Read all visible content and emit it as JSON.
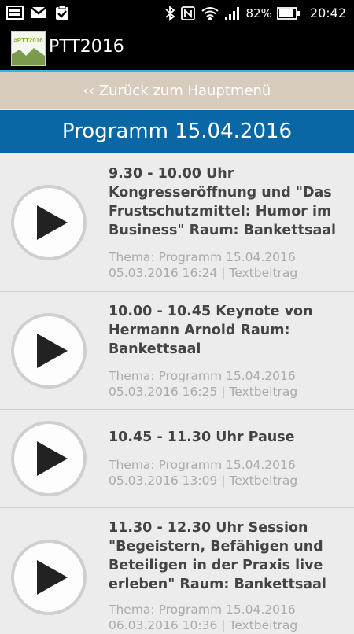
{
  "status_bar": {
    "left_icons": [
      "gallery-icon",
      "gmail-icon",
      "clipboard-check-icon"
    ],
    "battery_percent": "82%",
    "time": "20:42"
  },
  "app_bar": {
    "logo_text": "#PTT2016",
    "title": "PTT2016"
  },
  "back_link": "‹‹ Zurück zum Hauptmenü",
  "section_title": "Programm 15.04.2016",
  "items": [
    {
      "title_lines": [
        "9.30 - 10.00 Uhr",
        "Kongresseröffnung und \"Das",
        "Frustschutzmittel: Humor im",
        "Business\" Raum: Bankettsaal"
      ],
      "topic": "Thema: Programm 15.04.2016",
      "meta": "05.03.2016 16:24 | Textbeitrag"
    },
    {
      "title_lines": [
        "10.00 - 10.45 Keynote von",
        "Hermann Arnold Raum:",
        "Bankettsaal"
      ],
      "topic": "Thema: Programm 15.04.2016",
      "meta": "05.03.2016 16:25 | Textbeitrag"
    },
    {
      "title_lines": [
        "10.45 - 11.30 Uhr Pause"
      ],
      "topic": "Thema: Programm 15.04.2016",
      "meta": "05.03.2016 13:09 | Textbeitrag"
    },
    {
      "title_lines": [
        "11.30 - 12.30 Uhr Session",
        "\"Begeistern, Befähigen und",
        "Beteiligen in der Praxis live",
        "erleben\" Raum: Bankettsaal"
      ],
      "topic": "Thema: Programm 15.04.2016",
      "meta": "06.03.2016 10:36 | Textbeitrag"
    }
  ]
}
